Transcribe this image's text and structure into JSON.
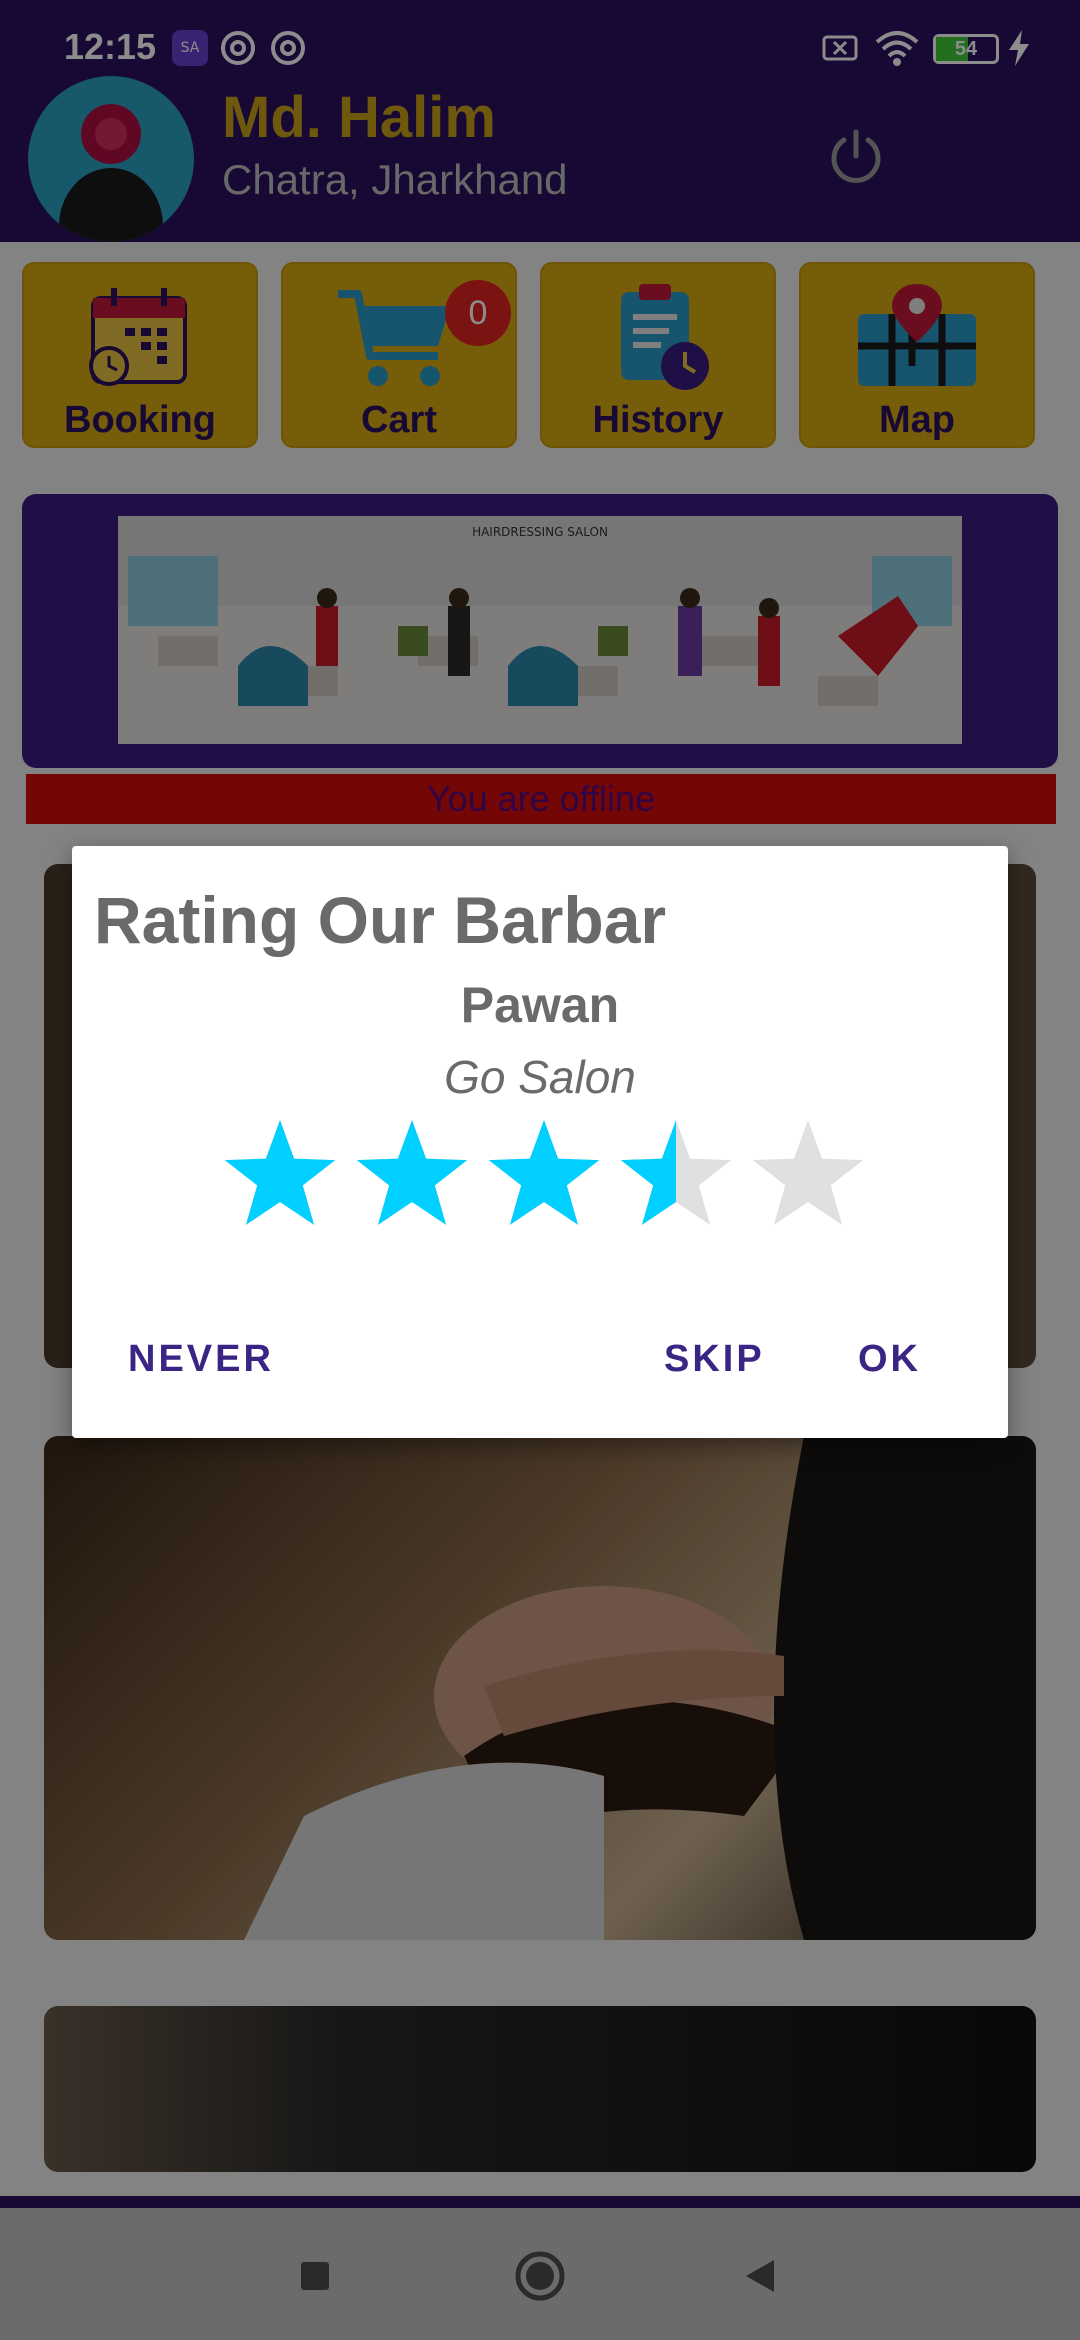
{
  "status_bar": {
    "time": "12:15",
    "battery": "54",
    "battery_level": 0.54,
    "icons": [
      "app-icon",
      "at-icon",
      "at-icon",
      "no-sim-icon",
      "wifi-icon",
      "battery-icon",
      "charging-icon"
    ]
  },
  "header": {
    "user_name": "Md. Halim",
    "user_location": "Chatra, Jharkhand",
    "icons": [
      "avatar-icon",
      "power-icon"
    ]
  },
  "tiles": [
    {
      "label": "Booking",
      "icon": "calendar-icon"
    },
    {
      "label": "Cart",
      "icon": "cart-icon",
      "badge": "0"
    },
    {
      "label": "History",
      "icon": "clipboard-clock-icon"
    },
    {
      "label": "Map",
      "icon": "map-pin-icon"
    }
  ],
  "banner": {
    "heading": "HAIRDRESSING SALON"
  },
  "offline_message": "You are offline",
  "dialog": {
    "title": "Rating Our Barbar",
    "barber_name": "Pawan",
    "salon_name": "Go Salon",
    "rating": 3.5,
    "max_rating": 5,
    "buttons": {
      "never": "NEVER",
      "skip": "SKIP",
      "ok": "OK"
    }
  },
  "nav_bar": {
    "icons": [
      "recents-square-icon",
      "home-circle-icon",
      "back-triangle-icon"
    ]
  },
  "colors": {
    "header": "#2a1260",
    "tile": "#d8a912",
    "star_filled": "#00cfff",
    "star_empty": "#e0e0e0",
    "accent": "#3a2484",
    "offline": "#d40c0c"
  }
}
